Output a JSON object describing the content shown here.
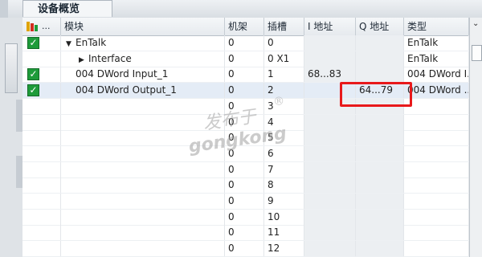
{
  "tab": {
    "title": "设备概览"
  },
  "columns": {
    "dots": "...",
    "module": "模块",
    "rack": "机架",
    "slot": "插槽",
    "i_addr": "I 地址",
    "q_addr": "Q 地址",
    "type": "类型"
  },
  "rows": [
    {
      "checked": true,
      "expand": "down",
      "module": "EnTalk",
      "rack": "0",
      "slot": "0",
      "i_addr": "",
      "q_addr": "",
      "type": "EnTalk",
      "indent": 1
    },
    {
      "checked": false,
      "expand": "right",
      "module": "Interface",
      "rack": "0",
      "slot": "0 X1",
      "i_addr": "",
      "q_addr": "",
      "type": "EnTalk",
      "indent": 2
    },
    {
      "checked": true,
      "expand": "",
      "module": "004 DWord Input_1",
      "rack": "0",
      "slot": "1",
      "i_addr": "68...83",
      "q_addr": "",
      "type": "004 DWord I...",
      "indent": 1
    },
    {
      "checked": true,
      "expand": "",
      "module": "004 DWord Output_1",
      "rack": "0",
      "slot": "2",
      "i_addr": "",
      "q_addr": "64...79",
      "type": "004 DWord ...",
      "indent": 1
    },
    {
      "checked": false,
      "expand": "",
      "module": "",
      "rack": "0",
      "slot": "3",
      "i_addr": "",
      "q_addr": "",
      "type": "",
      "indent": 1
    },
    {
      "checked": false,
      "expand": "",
      "module": "",
      "rack": "0",
      "slot": "4",
      "i_addr": "",
      "q_addr": "",
      "type": "",
      "indent": 1
    },
    {
      "checked": false,
      "expand": "",
      "module": "",
      "rack": "0",
      "slot": "5",
      "i_addr": "",
      "q_addr": "",
      "type": "",
      "indent": 1
    },
    {
      "checked": false,
      "expand": "",
      "module": "",
      "rack": "0",
      "slot": "6",
      "i_addr": "",
      "q_addr": "",
      "type": "",
      "indent": 1
    },
    {
      "checked": false,
      "expand": "",
      "module": "",
      "rack": "0",
      "slot": "7",
      "i_addr": "",
      "q_addr": "",
      "type": "",
      "indent": 1
    },
    {
      "checked": false,
      "expand": "",
      "module": "",
      "rack": "0",
      "slot": "8",
      "i_addr": "",
      "q_addr": "",
      "type": "",
      "indent": 1
    },
    {
      "checked": false,
      "expand": "",
      "module": "",
      "rack": "0",
      "slot": "9",
      "i_addr": "",
      "q_addr": "",
      "type": "",
      "indent": 1
    },
    {
      "checked": false,
      "expand": "",
      "module": "",
      "rack": "0",
      "slot": "10",
      "i_addr": "",
      "q_addr": "",
      "type": "",
      "indent": 1
    },
    {
      "checked": false,
      "expand": "",
      "module": "",
      "rack": "0",
      "slot": "11",
      "i_addr": "",
      "q_addr": "",
      "type": "",
      "indent": 1
    },
    {
      "checked": false,
      "expand": "",
      "module": "",
      "rack": "0",
      "slot": "12",
      "i_addr": "",
      "q_addr": "",
      "type": "",
      "indent": 1
    }
  ],
  "watermark": {
    "cn": "发布于",
    "en": "gongkong",
    "reg": "®"
  },
  "colors": {
    "check": "#1e9b3a",
    "highlight": "#e8191b",
    "selected_row": "#e4ecf6"
  },
  "icons": {
    "status": "status-warning-icon",
    "check": "checkmark-icon",
    "expand_down": "triangle-down-icon",
    "expand_right": "triangle-right-icon"
  }
}
